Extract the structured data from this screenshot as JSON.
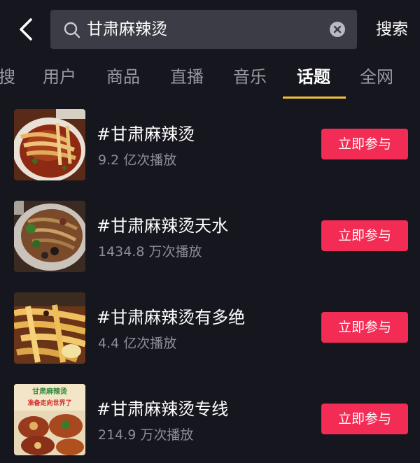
{
  "search": {
    "query": "甘肃麻辣烫",
    "submit_label": "搜索"
  },
  "tabs": [
    {
      "label": "搜"
    },
    {
      "label": "用户"
    },
    {
      "label": "商品"
    },
    {
      "label": "直播"
    },
    {
      "label": "音乐"
    },
    {
      "label": "话题"
    },
    {
      "label": "全网"
    }
  ],
  "active_tab": "话题",
  "accent_colors": {
    "tab_underline": "#f2c232",
    "join_button": "#f22c54"
  },
  "topics": [
    {
      "title": "#甘肃麻辣烫",
      "plays": "9.2 亿次播放",
      "button": "立即参与",
      "thumb_icon": "noodle-bowl-thumbnail"
    },
    {
      "title": "#甘肃麻辣烫天水",
      "plays": "1434.8 万次播放",
      "button": "立即参与",
      "thumb_icon": "noodle-dish-thumbnail"
    },
    {
      "title": "#甘肃麻辣烫有多绝",
      "plays": "4.4 亿次播放",
      "button": "立即参与",
      "thumb_icon": "noodle-closeup-thumbnail"
    },
    {
      "title": "#甘肃麻辣烫专线",
      "plays": "214.9 万次播放",
      "button": "立即参与",
      "thumb_icon": "food-poster-thumbnail"
    }
  ],
  "thumb_poster_text": [
    "甘肃麻辣烫",
    "准备走向世界了"
  ]
}
